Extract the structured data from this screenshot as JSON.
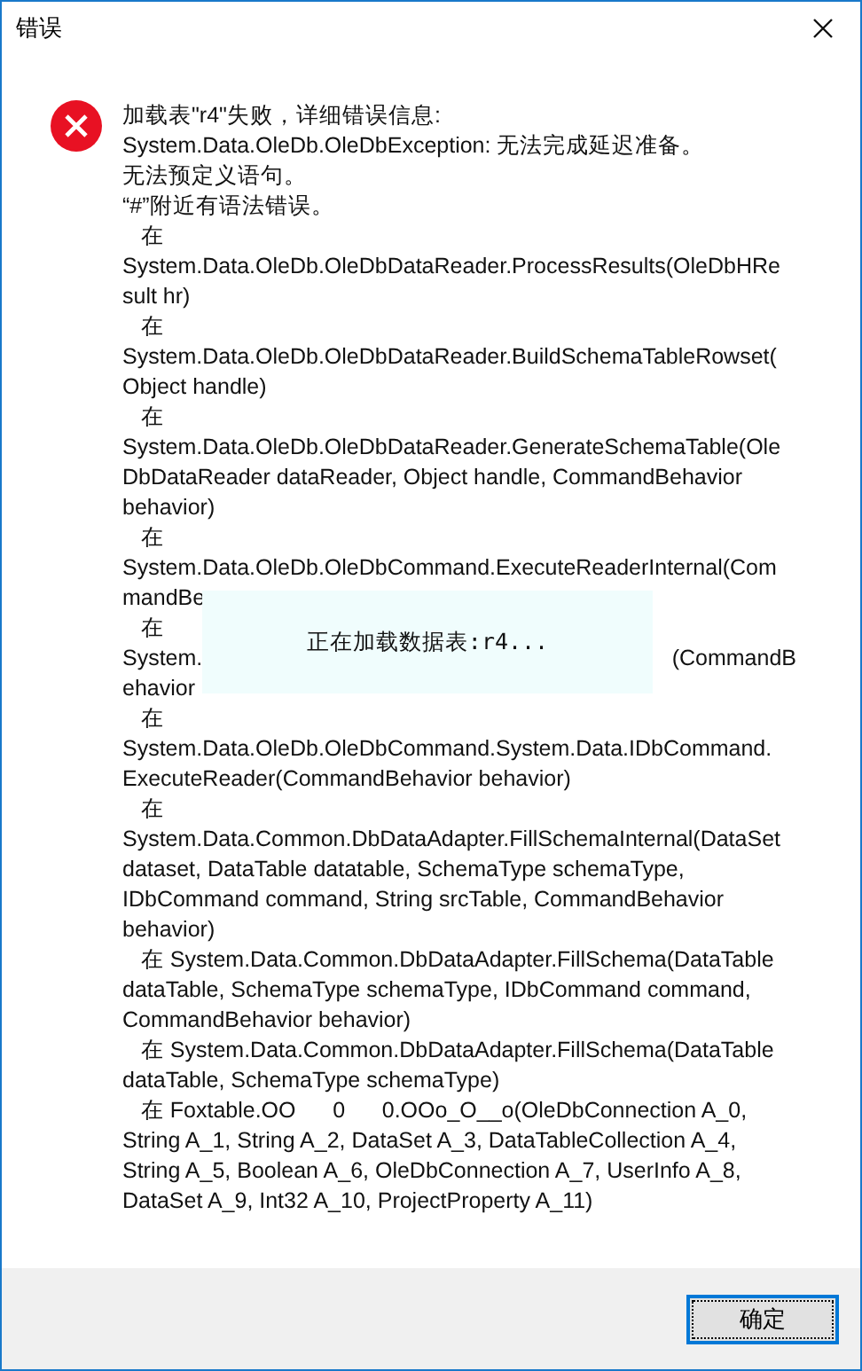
{
  "window": {
    "title": "错误"
  },
  "message": {
    "lines": [
      {
        "text": "加载表\"r4\"失败，详细错误信息:"
      },
      {
        "text": "System.Data.OleDb.OleDbException: 无法完成延迟准备。"
      },
      {
        "text": "无法预定义语句。"
      },
      {
        "text": "“#”附近有语法错误。"
      },
      {
        "text": "   在"
      },
      {
        "text": "System.Data.OleDb.OleDbDataReader.ProcessResults(OleDbHRe"
      },
      {
        "text": "sult hr)"
      },
      {
        "text": "   在"
      },
      {
        "text": "System.Data.OleDb.OleDbDataReader.BuildSchemaTableRowset("
      },
      {
        "text": "Object handle)"
      },
      {
        "text": "   在"
      },
      {
        "text": "System.Data.OleDb.OleDbDataReader.GenerateSchemaTable(Ole"
      },
      {
        "text": "DbDataReader dataReader, Object handle, CommandBehavior"
      },
      {
        "text": "behavior)"
      },
      {
        "text": "   在"
      },
      {
        "text": "System.Data.OleDb.OleDbCommand.ExecuteReaderInternal(Com"
      },
      {
        "text": "mandBe"
      },
      {
        "text": "   在"
      },
      {
        "text": "System.",
        "tail": "(CommandB"
      },
      {
        "text": "ehavior"
      },
      {
        "text": "   在"
      },
      {
        "text": "System.Data.OleDb.OleDbCommand.System.Data.IDbCommand."
      },
      {
        "text": "ExecuteReader(CommandBehavior behavior)"
      },
      {
        "text": "   在"
      },
      {
        "text": "System.Data.Common.DbDataAdapter.FillSchemaInternal(DataSet"
      },
      {
        "text": "dataset, DataTable datatable, SchemaType schemaType,"
      },
      {
        "text": "IDbCommand command, String srcTable, CommandBehavior"
      },
      {
        "text": "behavior)"
      },
      {
        "text": "   在 System.Data.Common.DbDataAdapter.FillSchema(DataTable"
      },
      {
        "text": "dataTable, SchemaType schemaType, IDbCommand command,"
      },
      {
        "text": "CommandBehavior behavior)"
      },
      {
        "text": "   在 System.Data.Common.DbDataAdapter.FillSchema(DataTable"
      },
      {
        "text": "dataTable, SchemaType schemaType)"
      },
      {
        "text": "   在 Foxtable.OO      0      0.OOo_O__o(OleDbConnection A_0,"
      },
      {
        "text": "String A_1, String A_2, DataSet A_3, DataTableCollection A_4,"
      },
      {
        "text": "String A_5, Boolean A_6, OleDbConnection A_7, UserInfo A_8,"
      },
      {
        "text": "DataSet A_9, Int32 A_10, ProjectProperty A_11)"
      }
    ]
  },
  "loading_popup": {
    "text": "正在加载数据表:r4..."
  },
  "buttons": [
    {
      "label": "确定",
      "focused": true
    }
  ]
}
